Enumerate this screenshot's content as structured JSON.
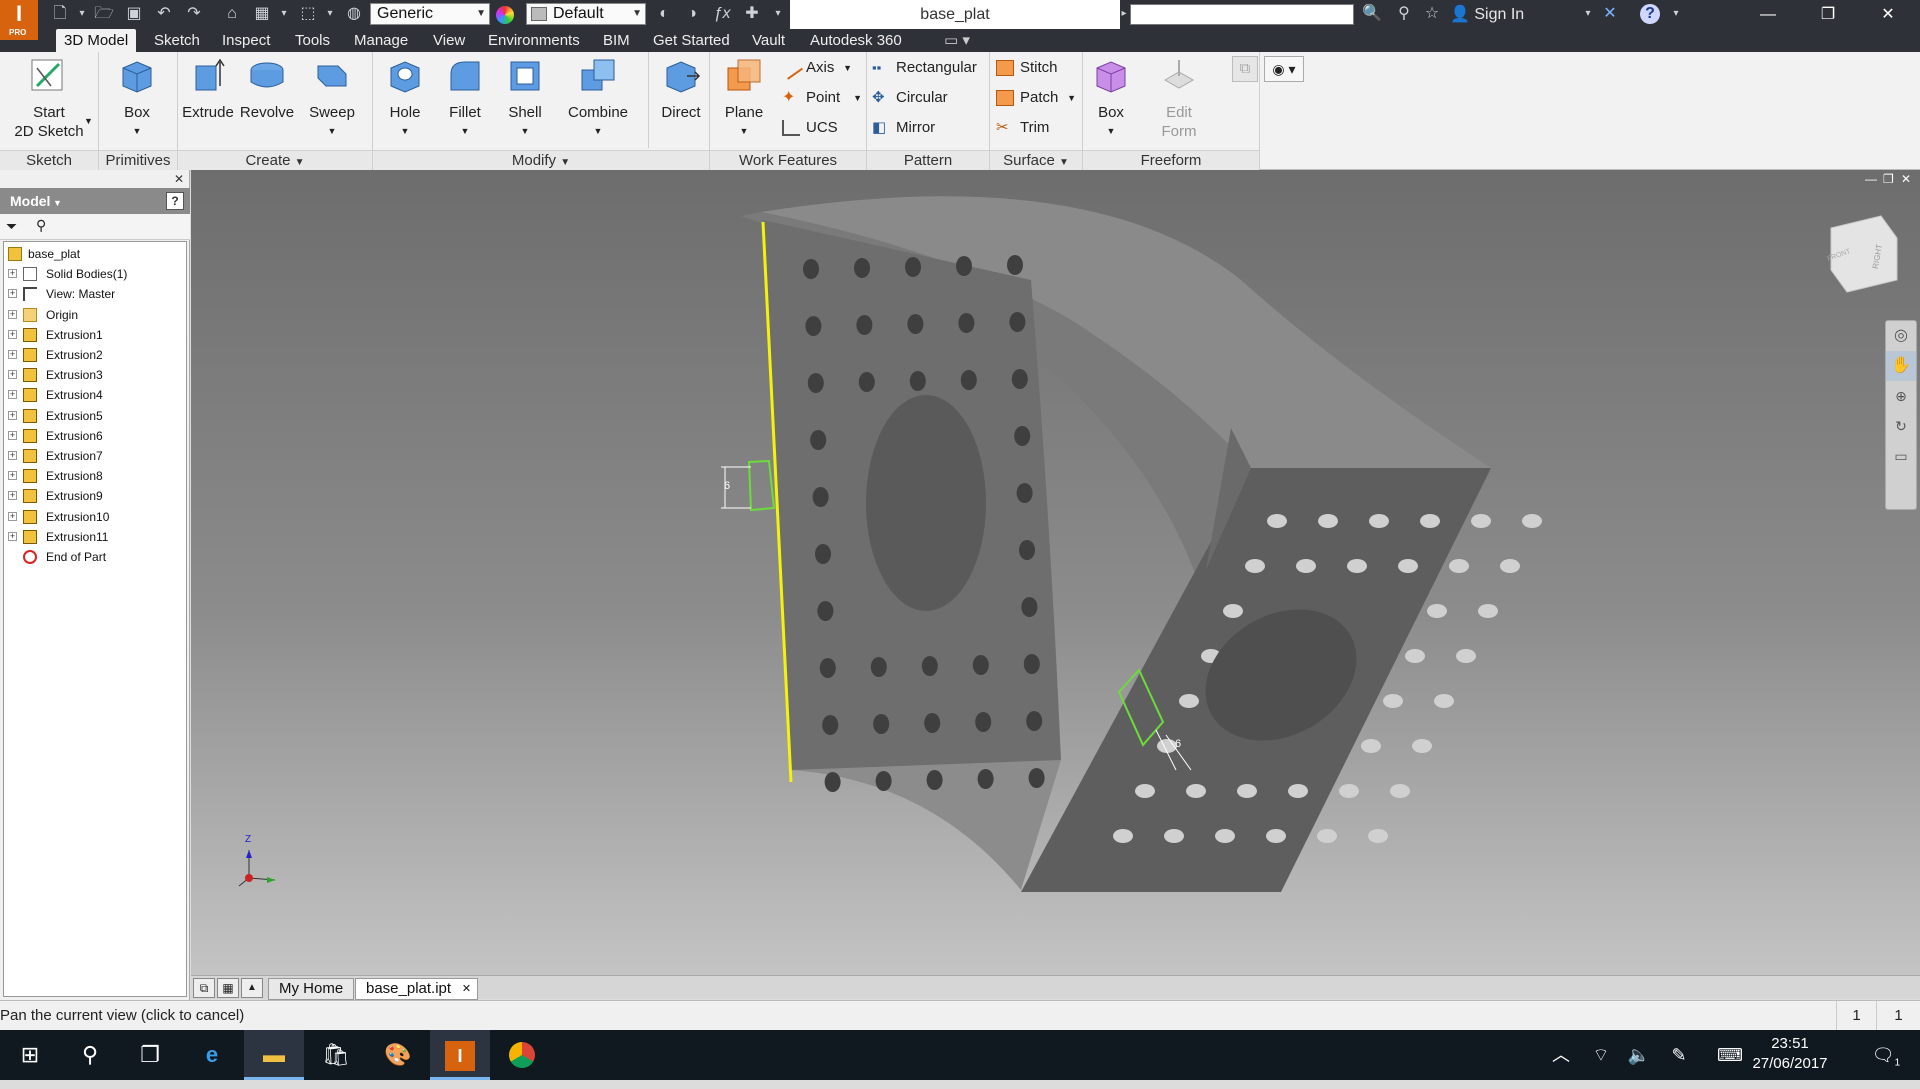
{
  "titlebar": {
    "app_logo": "I",
    "app_logo_sub": "PRO",
    "quick_access_icons": [
      "new-file-icon",
      "dropdown-icon",
      "open-folder-icon",
      "save-icon",
      "undo-icon",
      "redo-icon",
      "home-icon",
      "image-icon",
      "dropdown-icon",
      "select-icon",
      "dropdown-icon",
      "color-wheel-icon"
    ],
    "material_value": "Generic",
    "appearance_value": "Default",
    "document_title": "base_plat",
    "sign_in": "Sign In",
    "window_controls": [
      "minimize-icon",
      "restore-icon",
      "close-icon"
    ]
  },
  "menubar": {
    "tabs": [
      "3D Model",
      "Sketch",
      "Inspect",
      "Tools",
      "Manage",
      "View",
      "Environments",
      "BIM",
      "Get Started",
      "Vault",
      "Autodesk 360"
    ],
    "active": "3D Model"
  },
  "ribbon": {
    "panels": [
      "Sketch",
      "Primitives",
      "Create",
      "Modify",
      "Work Features",
      "Pattern",
      "Surface",
      "Freeform"
    ],
    "sketch": {
      "start_line1": "Start",
      "start_line2": "2D Sketch"
    },
    "primitives": {
      "box": "Box"
    },
    "create": {
      "extrude": "Extrude",
      "revolve": "Revolve",
      "sweep": "Sweep"
    },
    "modify": {
      "hole": "Hole",
      "fillet": "Fillet",
      "shell": "Shell",
      "combine": "Combine",
      "direct": "Direct"
    },
    "work_features": {
      "plane": "Plane",
      "axis": "Axis",
      "point": "Point",
      "ucs": "UCS"
    },
    "pattern": {
      "rectangular": "Rectangular",
      "circular": "Circular",
      "mirror": "Mirror"
    },
    "surface": {
      "stitch": "Stitch",
      "patch": "Patch",
      "trim": "Trim"
    },
    "freeform": {
      "box": "Box",
      "edit_line1": "Edit",
      "edit_line2": "Form"
    }
  },
  "browser": {
    "header": "Model",
    "nodes": [
      {
        "label": "base_plat",
        "icon": "part-icon",
        "expandable": false
      },
      {
        "label": "Solid Bodies(1)",
        "icon": "solid-bodies-icon",
        "expandable": true
      },
      {
        "label": "View: Master",
        "icon": "view-icon",
        "expandable": true
      },
      {
        "label": "Origin",
        "icon": "folder-icon",
        "expandable": true
      },
      {
        "label": "Extrusion1",
        "icon": "extrusion-icon",
        "expandable": true
      },
      {
        "label": "Extrusion2",
        "icon": "extrusion-icon",
        "expandable": true
      },
      {
        "label": "Extrusion3",
        "icon": "extrusion-icon",
        "expandable": true
      },
      {
        "label": "Extrusion4",
        "icon": "extrusion-icon",
        "expandable": true
      },
      {
        "label": "Extrusion5",
        "icon": "extrusion-icon",
        "expandable": true
      },
      {
        "label": "Extrusion6",
        "icon": "extrusion-icon",
        "expandable": true
      },
      {
        "label": "Extrusion7",
        "icon": "extrusion-icon",
        "expandable": true
      },
      {
        "label": "Extrusion8",
        "icon": "extrusion-icon",
        "expandable": true
      },
      {
        "label": "Extrusion9",
        "icon": "extrusion-icon",
        "expandable": true
      },
      {
        "label": "Extrusion10",
        "icon": "extrusion-icon",
        "expandable": true
      },
      {
        "label": "Extrusion11",
        "icon": "extrusion-icon",
        "expandable": true
      },
      {
        "label": "End of Part",
        "icon": "end-of-part-icon",
        "expandable": false
      }
    ]
  },
  "viewport": {
    "dimension_left": "6",
    "dimension_right": "6",
    "viewcube_face": "RIGHT",
    "viewcube_side": "FRONT",
    "triad_label": "Z"
  },
  "doc_tabs": [
    "My Home",
    "base_plat.ipt"
  ],
  "status": {
    "message": "Pan the current view (click to cancel)",
    "count1": "1",
    "count2": "1"
  },
  "taskbar": {
    "time": "23:51",
    "date": "27/06/2017",
    "notifications": "1"
  },
  "colors": {
    "accent_orange": "#d7630f",
    "selection_green": "#6bdc3a",
    "highlight_yellow": "#f4f10a"
  }
}
